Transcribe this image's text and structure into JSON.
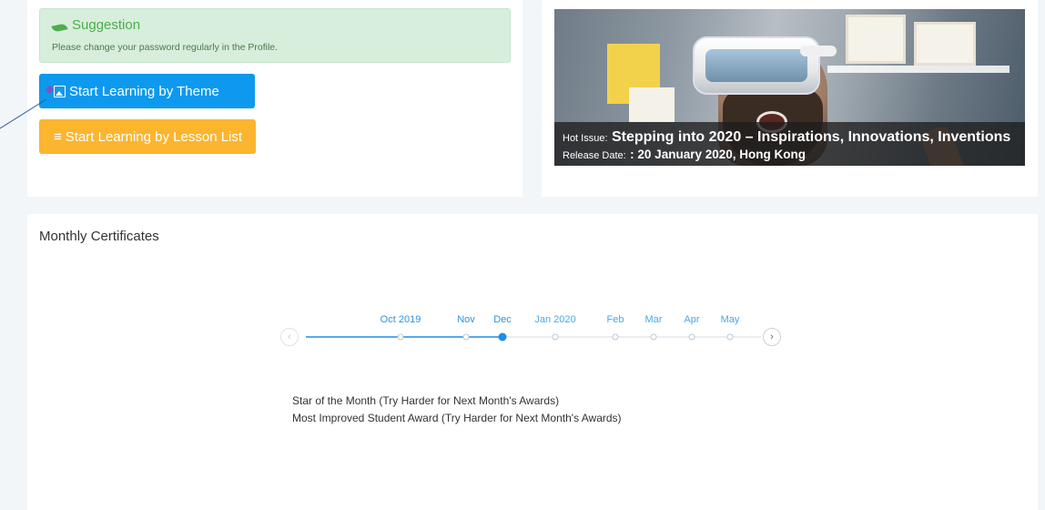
{
  "suggestion": {
    "title": "Suggestion",
    "text": "Please change your password regularly in the Profile.",
    "color": "#4cae4c"
  },
  "buttons": {
    "theme_label": "Start Learning by Theme",
    "lesson_label": "Start Learning by Lesson List",
    "theme_color": "#0d99ee",
    "lesson_color": "#fbb52f"
  },
  "banner": {
    "hot_issue_label": "Hot Issue:",
    "hot_issue_title": "Stepping into 2020 – Inspirations, Innovations, Inventions",
    "release_label": "Release Date:",
    "release_value": ": 20 January 2020, Hong Kong"
  },
  "certificates": {
    "title": "Monthly Certificates",
    "months": [
      {
        "label": "Oct 2019",
        "state": "past"
      },
      {
        "label": "Nov",
        "state": "past"
      },
      {
        "label": "Dec",
        "state": "active"
      },
      {
        "label": "Jan 2020",
        "state": "future"
      },
      {
        "label": "Feb",
        "state": "future"
      },
      {
        "label": "Mar",
        "state": "future"
      },
      {
        "label": "Apr",
        "state": "future"
      },
      {
        "label": "May",
        "state": "future"
      }
    ],
    "prev_icon": "chevron-left-icon",
    "next_icon": "chevron-right-icon",
    "awards": [
      "Star of the Month (Try Harder for Next Month's Awards)",
      "Most Improved Student Award (Try Harder for Next Month's Awards)"
    ],
    "accent": "#1e8ee5"
  }
}
